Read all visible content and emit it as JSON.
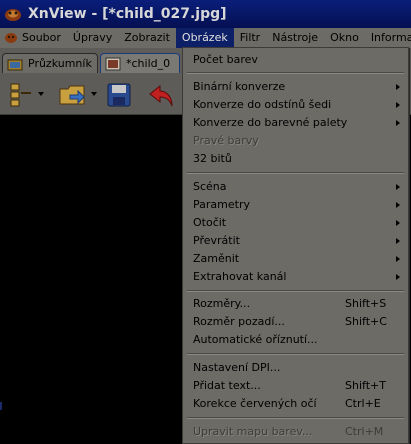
{
  "window": {
    "title": "XnView - [*child_027.jpg]"
  },
  "menubar": {
    "items": [
      "Soubor",
      "Úpravy",
      "Zobrazit",
      "Obrázek",
      "Filtr",
      "Nástroje",
      "Okno",
      "Informace"
    ],
    "active_index": 3
  },
  "tabs": [
    {
      "label": "Průzkumník"
    },
    {
      "label": "*child_0"
    }
  ],
  "toolbar": {
    "buttons": [
      "browser-icon",
      "open-folder-icon",
      "save-icon",
      "undo-icon"
    ]
  },
  "dropdown": {
    "items": [
      {
        "label": "Počet barev",
        "shortcut": "",
        "submenu": false,
        "disabled": false
      },
      {
        "label": "Binární konverze",
        "shortcut": "",
        "submenu": true,
        "disabled": false
      },
      {
        "label": "Konverze do odstínů šedi",
        "shortcut": "",
        "submenu": true,
        "disabled": false
      },
      {
        "label": "Konverze do barevné palety",
        "shortcut": "",
        "submenu": true,
        "disabled": false
      },
      {
        "label": "Pravé barvy",
        "shortcut": "",
        "submenu": false,
        "disabled": true
      },
      {
        "label": "32 bitů",
        "shortcut": "",
        "submenu": false,
        "disabled": false
      },
      {
        "label": "Scéna",
        "shortcut": "",
        "submenu": true,
        "disabled": false
      },
      {
        "label": "Parametry",
        "shortcut": "",
        "submenu": true,
        "disabled": false
      },
      {
        "label": "Otočit",
        "shortcut": "",
        "submenu": true,
        "disabled": false
      },
      {
        "label": "Převrátit",
        "shortcut": "",
        "submenu": true,
        "disabled": false
      },
      {
        "label": "Zaměnit",
        "shortcut": "",
        "submenu": true,
        "disabled": false
      },
      {
        "label": "Extrahovat kanál",
        "shortcut": "",
        "submenu": true,
        "disabled": false
      },
      {
        "label": "Rozměry...",
        "shortcut": "Shift+S",
        "submenu": false,
        "disabled": false
      },
      {
        "label": "Rozměr pozadí...",
        "shortcut": "Shift+C",
        "submenu": false,
        "disabled": false
      },
      {
        "label": "Automatické oříznutí...",
        "shortcut": "",
        "submenu": false,
        "disabled": false
      },
      {
        "label": "Nastavení DPI...",
        "shortcut": "",
        "submenu": false,
        "disabled": false
      },
      {
        "label": "Přidat text...",
        "shortcut": "Shift+T",
        "submenu": false,
        "disabled": false
      },
      {
        "label": "Korekce červených očí",
        "shortcut": "Ctrl+E",
        "submenu": false,
        "disabled": false
      },
      {
        "label": "Upravit mapu barev...",
        "shortcut": "Ctrl+M",
        "submenu": false,
        "disabled": true
      }
    ]
  },
  "colors": {
    "titlebar": "#0a1e7a",
    "menu_bg": "#6c6b66",
    "menu_highlight": "#0d1f66",
    "content_bg": "#000000"
  }
}
